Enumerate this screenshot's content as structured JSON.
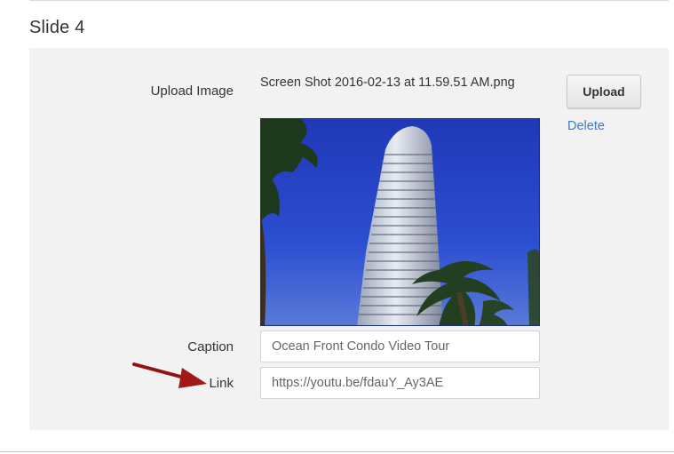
{
  "slide": {
    "title": "Slide 4"
  },
  "upload": {
    "label": "Upload Image",
    "filename": "Screen Shot 2016-02-13 at 11.59.51 AM.png",
    "button_label": "Upload",
    "delete_label": "Delete"
  },
  "caption": {
    "label": "Caption",
    "placeholder": "Ocean Front Condo Video Tour"
  },
  "link": {
    "label": "Link",
    "placeholder": "https://youtu.be/fdauY_Ay3AE"
  },
  "colors": {
    "panel_bg": "#f2f2f2",
    "link_blue": "#3a7bc8",
    "arrow_red": "#a01818",
    "sky_blue": "#2a47c4"
  },
  "icons": {
    "annotation": "red-arrow-icon"
  }
}
